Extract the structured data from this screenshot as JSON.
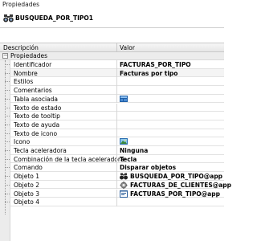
{
  "panel": {
    "title": "Propiedades"
  },
  "object": {
    "name": "BUSQUEDA_POR_TIPO1",
    "icon": "binoculars-icon"
  },
  "columns": {
    "name": "Descripción",
    "value": "Valor"
  },
  "category": {
    "label": "Propiedades",
    "toggle": "−",
    "expanded": true
  },
  "rows": [
    {
      "name": "Identificador",
      "value": "FACTURAS_POR_TIPO",
      "icon": ""
    },
    {
      "name": "Nombre",
      "value": "Facturas por tipo",
      "icon": ""
    },
    {
      "name": "Estilos",
      "value": "",
      "icon": ""
    },
    {
      "name": "Comentarios",
      "value": "",
      "icon": ""
    },
    {
      "name": "Tabla asociada",
      "value": "",
      "icon": "table-icon"
    },
    {
      "name": "Texto de estado",
      "value": "",
      "icon": ""
    },
    {
      "name": "Texto de tooltip",
      "value": "",
      "icon": ""
    },
    {
      "name": "Texto de ayuda",
      "value": "",
      "icon": ""
    },
    {
      "name": "Texto de icono",
      "value": "",
      "icon": ""
    },
    {
      "name": "Icono",
      "value": "",
      "icon": "image-icon"
    },
    {
      "name": "Tecla aceleradora",
      "value": "Ninguna",
      "icon": ""
    },
    {
      "name": "Combinación de la tecla aceleradora",
      "value": "Tecla",
      "icon": ""
    },
    {
      "name": "Comando",
      "value": "Disparar objetos",
      "icon": ""
    },
    {
      "name": "Objeto 1",
      "value": "BUSQUEDA_POR_TIPO@app",
      "icon": "binoculars-icon"
    },
    {
      "name": "Objeto 2",
      "value": "FACTURAS_DE_CLIENTES@app",
      "icon": "gear-icon"
    },
    {
      "name": "Objeto 3",
      "value": "FACTURAS_POR_TIPO@app",
      "icon": "form-icon"
    },
    {
      "name": "Objeto 4",
      "value": "",
      "icon": ""
    }
  ],
  "colors": {
    "category_bg": "#ececec",
    "grid_line": "#e2e2e2",
    "header_bg": "#e6e6e6"
  }
}
